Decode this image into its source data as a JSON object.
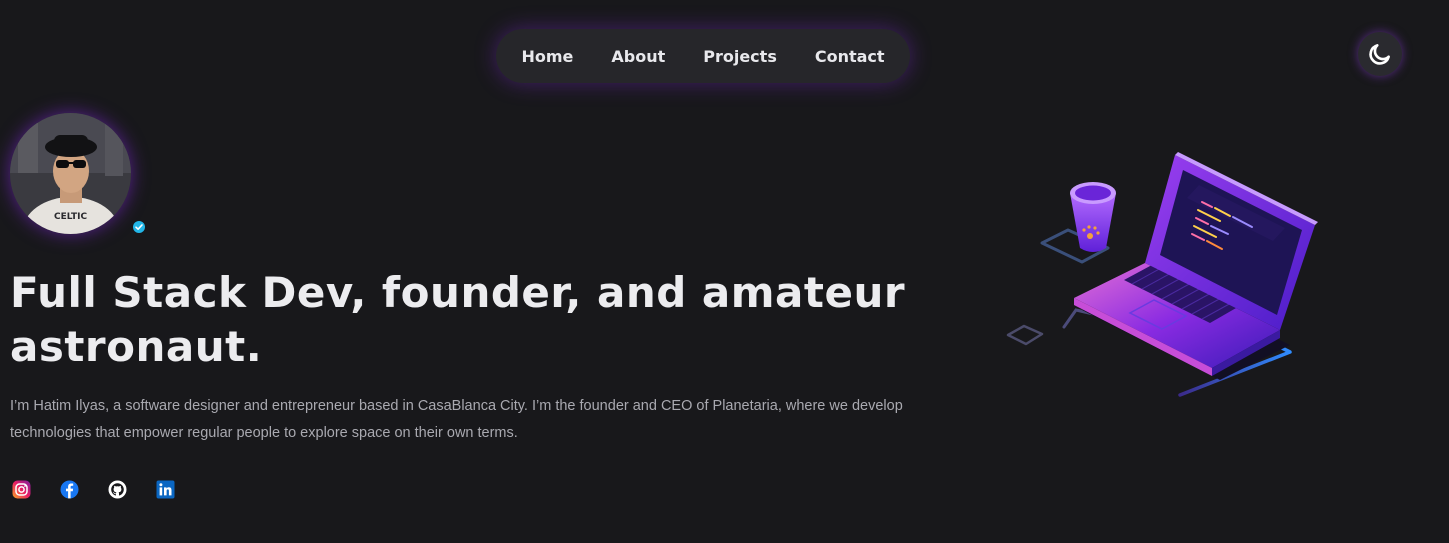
{
  "nav": {
    "items": [
      {
        "label": "Home"
      },
      {
        "label": "About"
      },
      {
        "label": "Projects"
      },
      {
        "label": "Contact"
      }
    ]
  },
  "theme_toggle": {
    "icon": "moon-icon"
  },
  "profile": {
    "avatar_icon": "avatar",
    "verified_icon": "verified-badge-icon"
  },
  "hero": {
    "headline": "Full Stack Dev, founder, and amateur astronaut.",
    "bio": "I’m Hatim Ilyas, a software designer and entrepreneur based in CasaBlanca City. I’m the founder and CEO of Planetaria, where we develop technologies that empower regular people to explore space on their own terms."
  },
  "socials": [
    {
      "name": "instagram-icon"
    },
    {
      "name": "facebook-icon"
    },
    {
      "name": "github-icon"
    },
    {
      "name": "linkedin-icon"
    }
  ],
  "colors": {
    "background": "#18181b",
    "nav_bg": "#26262a",
    "accent_glow": "#7c2ccf",
    "text": "#ececef",
    "muted_text": "#a9a9b0"
  }
}
